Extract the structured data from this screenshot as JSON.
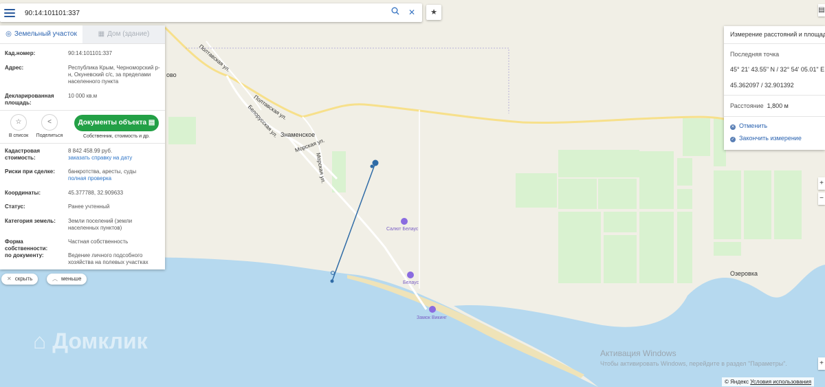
{
  "search": {
    "value": "90:14:101101:337",
    "search_icon": "search-icon",
    "clear_icon": "close-icon",
    "star_icon": "star-icon"
  },
  "panel": {
    "tabs": [
      {
        "label": "Земельный участок",
        "icon": "location-pin-icon"
      },
      {
        "label": "Дом (здание)",
        "icon": "building-icon"
      }
    ],
    "cad_label": "Кад.номер:",
    "cad_value": "90:14:101101:337",
    "address_label": "Адрес:",
    "address_value": "Республика Крым, Черноморский р-н, Окуневский с/с, за пределами населенного пункта",
    "area_label": "Декларированная площадь:",
    "area_value": "10 000 кв.м",
    "actions": {
      "list_label": "В список",
      "share_label": "Поделиться"
    },
    "docs_button": "Документы объекта",
    "docs_sub": "Собственник, стоимость и др.",
    "cost_label": "Кадастровая стоимость:",
    "cost_value": "8 842 458.99 руб.",
    "cost_link": "заказать справку на дату",
    "risk_label": "Риски при сделке:",
    "risk_value": "банкротства, аресты, суды",
    "risk_link": "полная проверка",
    "coords_label": "Координаты:",
    "coords_value": "45.377788, 32.909633",
    "status_label": "Статус:",
    "status_value": "Ранее учтенный",
    "category_label": "Категория земель:",
    "category_value": "Земли поселений (земли населенных пунктов)",
    "ownership_label": "Форма собственности:",
    "ownership_value": "Частная собственность",
    "doc_label": "по документу:",
    "doc_value": "Ведение личного подсобного хозяйства на полевых участках"
  },
  "pills": {
    "hide": "скрыть",
    "less": "меньше"
  },
  "measure": {
    "title": "Измерение расстояний и площади",
    "last_point_label": "Последняя точка",
    "dms": "45° 21' 43.55\" N / 32° 54' 05.01\" E",
    "decimal": "45.362097 / 32.901392",
    "distance_label": "Расстояние",
    "distance_value": "1,800 м",
    "cancel": "Отменить",
    "finish": "Закончить измерение"
  },
  "map_labels": {
    "poltavskaya1": "Полтавская ул.",
    "poltavskaya2": "Полтавская ул.",
    "belorusskaya": "Белорусская ул.",
    "morskaya1": "Морская ул.",
    "morskaya2": "Морская ул.",
    "znamenskoe": "Знаменское",
    "ozerovka": "Озеровка",
    "vo": "ово",
    "poi_salyut": "Салют Белаус",
    "poi_belyaus": "Белаус",
    "poi_zamok": "Замок Викинг"
  },
  "watermark": "Домклик",
  "activation": {
    "line1": "Активация Windows",
    "line2": "Чтобы активировать Windows, перейдите в раздел \"Параметры\"."
  },
  "copyright": {
    "yandex": "© Яндекс",
    "terms": "Условия использования"
  },
  "colors": {
    "sea": "#b6d9ef",
    "land": "#f1efe6",
    "fields": "#d9f2d0",
    "road": "#f7e08b",
    "measure_line": "#2f6ba6",
    "button_green": "#23a046",
    "link": "#2b73c7"
  }
}
